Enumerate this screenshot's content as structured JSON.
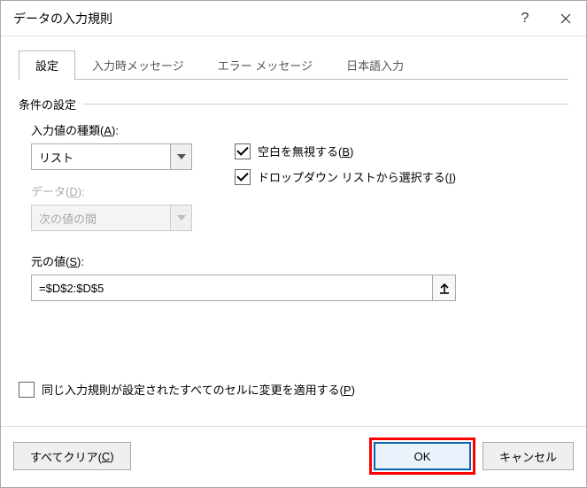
{
  "title": "データの入力規則",
  "tabs": {
    "settings": "設定",
    "input_msg": "入力時メッセージ",
    "error_msg": "エラー メッセージ",
    "ime": "日本語入力"
  },
  "fieldset_label": "条件の設定",
  "allow_label_pre": "入力値の種類(",
  "allow_label_key": "A",
  "allow_label_post": "):",
  "allow_value": "リスト",
  "data_label_pre": "データ(",
  "data_label_key": "D",
  "data_label_post": "):",
  "data_value": "次の値の間",
  "ignore_blank_pre": "空白を無視する(",
  "ignore_blank_key": "B",
  "ignore_blank_post": ")",
  "dropdown_pre": "ドロップダウン リストから選択する(",
  "dropdown_key": "I",
  "dropdown_post": ")",
  "source_label_pre": "元の値(",
  "source_label_key": "S",
  "source_label_post": "):",
  "source_value": "=$D$2:$D$5",
  "apply_all_pre": "同じ入力規則が設定されたすべてのセルに変更を適用する(",
  "apply_all_key": "P",
  "apply_all_post": ")",
  "clear_all_pre": "すべてクリア(",
  "clear_all_key": "C",
  "clear_all_post": ")",
  "ok": "OK",
  "cancel": "キャンセル"
}
